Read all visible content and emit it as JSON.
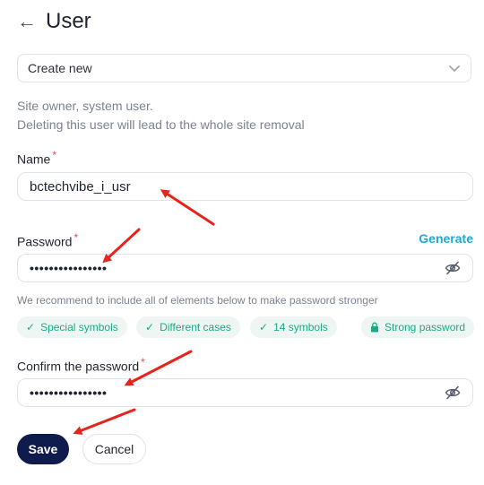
{
  "header": {
    "back_icon": "arrow-left-icon",
    "title": "User"
  },
  "select": {
    "value": "Create new",
    "icon": "chevron-down-icon"
  },
  "info": {
    "line1": "Site owner, system user.",
    "line2": "Deleting this user will lead to the whole site removal"
  },
  "name_field": {
    "label": "Name",
    "required_mark": "*",
    "value": "bctechvibe_i_usr"
  },
  "password_field": {
    "label": "Password",
    "required_mark": "*",
    "value": "••••••••••••••••",
    "generate_label": "Generate",
    "eye_icon": "eye-slash-icon"
  },
  "hint": "We recommend to include all of elements below to make password stronger",
  "chips": [
    {
      "icon": "check-icon",
      "label": "Special symbols"
    },
    {
      "icon": "check-icon",
      "label": "Different cases"
    },
    {
      "icon": "check-icon",
      "label": "14 symbols"
    },
    {
      "icon": "lock-icon",
      "label": "Strong password"
    }
  ],
  "confirm_field": {
    "label": "Confirm the password",
    "required_mark": "*",
    "value": "••••••••••••••••",
    "eye_icon": "eye-slash-icon"
  },
  "actions": {
    "save_label": "Save",
    "cancel_label": "Cancel"
  },
  "colors": {
    "accent": "#1ea9d6",
    "primary_button": "#0f1b4d",
    "chip_text": "#1aaa86",
    "chip_bg": "#eef6f3",
    "required": "#e5484d",
    "annotation_arrow": "#e8231c"
  }
}
